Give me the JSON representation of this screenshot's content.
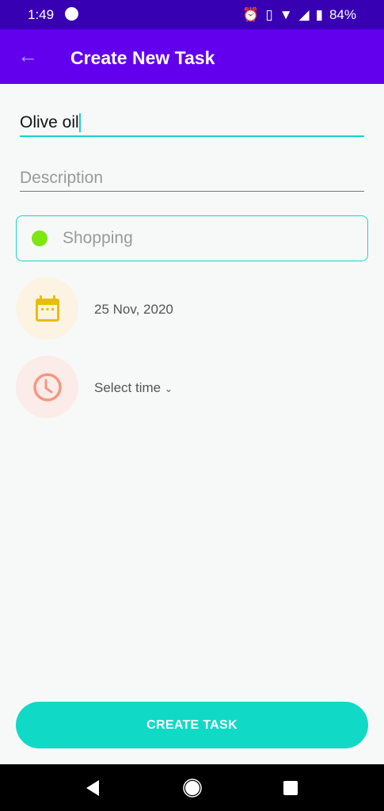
{
  "status": {
    "time": "1:49",
    "battery": "84%"
  },
  "appbar": {
    "back_icon": "arrow-left",
    "title": "Create New Task"
  },
  "form": {
    "title_value": "Olive oil",
    "description_placeholder": "Description",
    "category": "Shopping",
    "category_color": "#7ee612",
    "date": "25 Nov, 2020",
    "time_label": "Select time"
  },
  "button": {
    "label": "CREATE TASK"
  }
}
